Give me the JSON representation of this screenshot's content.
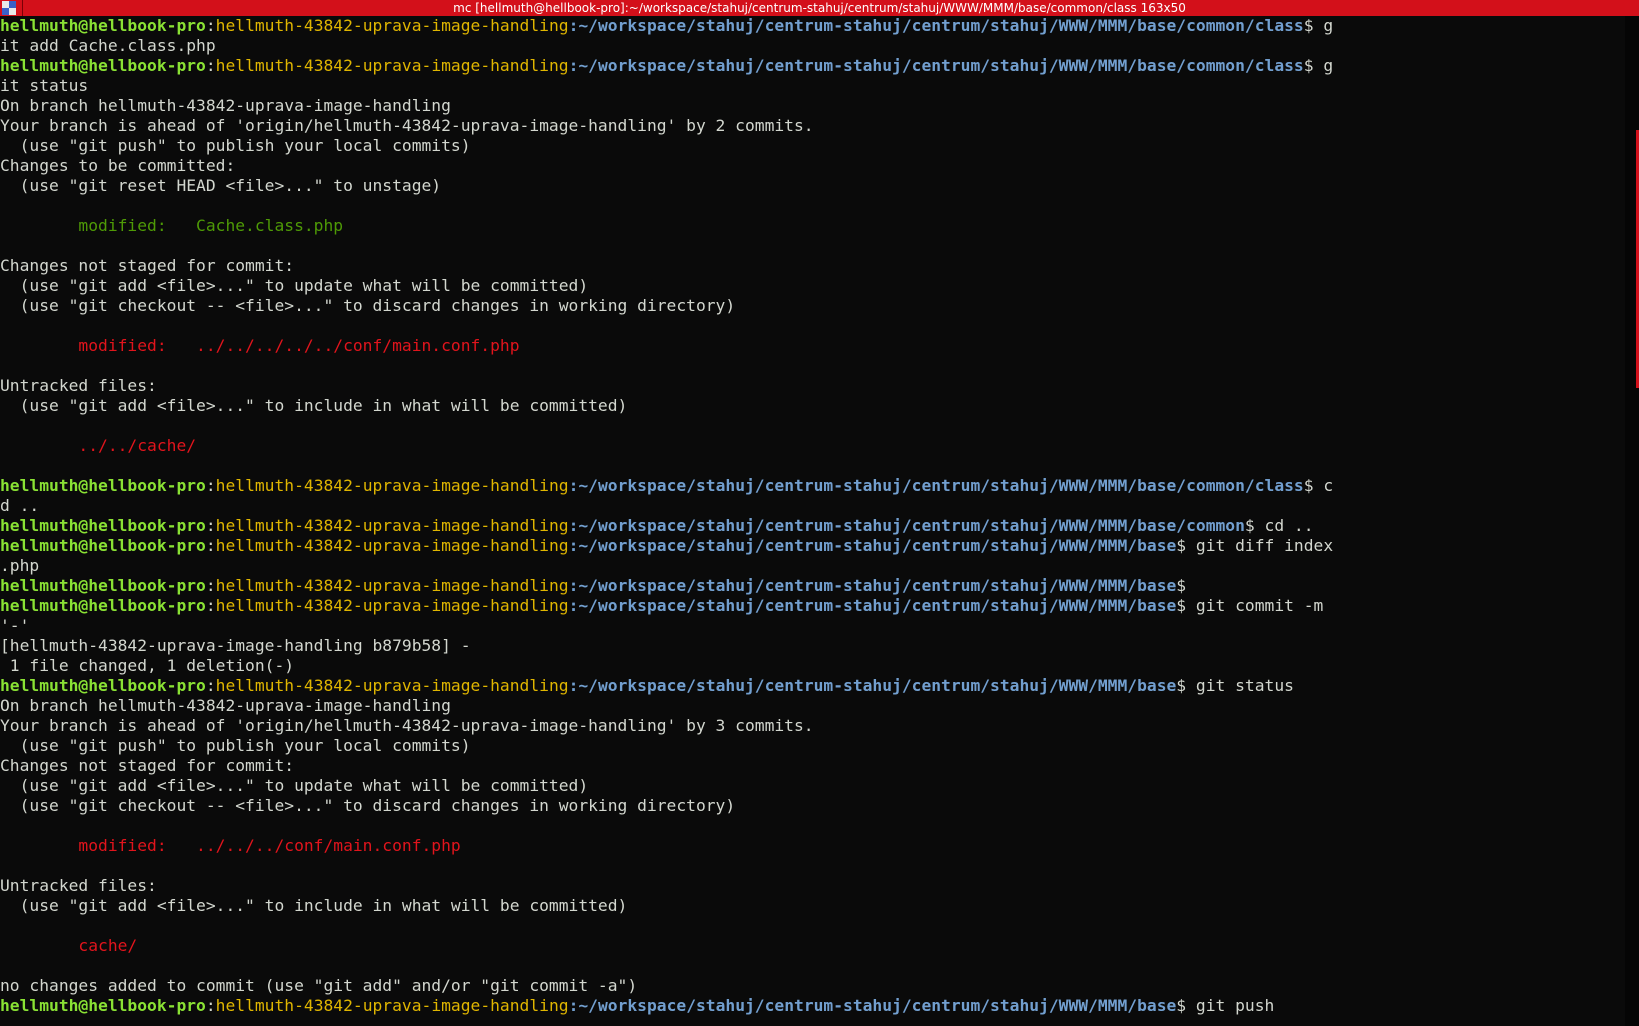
{
  "window": {
    "title": "mc [hellmuth@hellbook-pro]:~/workspace/stahuj/centrum-stahuj/centrum/stahuj/WWW/MMM/base/common/class 163x50"
  },
  "colors": {
    "title_bar": "#d3101a",
    "user_host": "#8ae234",
    "branch": "#e0b600",
    "path": "#729fcf",
    "text": "#d3d7cf",
    "staged": "#4e9a06",
    "unstaged": "#e1141c"
  },
  "terminal": {
    "lines": [
      [
        {
          "t": "hellmuth@hellbook-pro",
          "c": "user"
        },
        {
          "t": ":",
          "c": "plain"
        },
        {
          "t": "hellmuth-43842-uprava-image-handling",
          "c": "branch"
        },
        {
          "t": ":~/workspace/stahuj/centrum-stahuj/centrum/stahuj/WWW/MMM/base/common/class",
          "c": "path"
        },
        {
          "t": "$ g",
          "c": "plain"
        }
      ],
      [
        {
          "t": "it add Cache.class.php",
          "c": "plain"
        }
      ],
      [
        {
          "t": "hellmuth@hellbook-pro",
          "c": "user"
        },
        {
          "t": ":",
          "c": "plain"
        },
        {
          "t": "hellmuth-43842-uprava-image-handling",
          "c": "branch"
        },
        {
          "t": ":~/workspace/stahuj/centrum-stahuj/centrum/stahuj/WWW/MMM/base/common/class",
          "c": "path"
        },
        {
          "t": "$ g",
          "c": "plain"
        }
      ],
      [
        {
          "t": "it status",
          "c": "plain"
        }
      ],
      [
        {
          "t": "On branch hellmuth-43842-uprava-image-handling",
          "c": "plain"
        }
      ],
      [
        {
          "t": "Your branch is ahead of 'origin/hellmuth-43842-uprava-image-handling' by 2 commits.",
          "c": "plain"
        }
      ],
      [
        {
          "t": "  (use \"git push\" to publish your local commits)",
          "c": "plain"
        }
      ],
      [
        {
          "t": "Changes to be committed:",
          "c": "plain"
        }
      ],
      [
        {
          "t": "  (use \"git reset HEAD <file>...\" to unstage)",
          "c": "plain"
        }
      ],
      [
        {
          "t": "",
          "c": "plain"
        }
      ],
      [
        {
          "t": "        modified:   Cache.class.php",
          "c": "green"
        }
      ],
      [
        {
          "t": "",
          "c": "plain"
        }
      ],
      [
        {
          "t": "Changes not staged for commit:",
          "c": "plain"
        }
      ],
      [
        {
          "t": "  (use \"git add <file>...\" to update what will be committed)",
          "c": "plain"
        }
      ],
      [
        {
          "t": "  (use \"git checkout -- <file>...\" to discard changes in working directory)",
          "c": "plain"
        }
      ],
      [
        {
          "t": "",
          "c": "plain"
        }
      ],
      [
        {
          "t": "        modified:   ../../../../../conf/main.conf.php",
          "c": "red"
        }
      ],
      [
        {
          "t": "",
          "c": "plain"
        }
      ],
      [
        {
          "t": "Untracked files:",
          "c": "plain"
        }
      ],
      [
        {
          "t": "  (use \"git add <file>...\" to include in what will be committed)",
          "c": "plain"
        }
      ],
      [
        {
          "t": "",
          "c": "plain"
        }
      ],
      [
        {
          "t": "        ../../cache/",
          "c": "red"
        }
      ],
      [
        {
          "t": "",
          "c": "plain"
        }
      ],
      [
        {
          "t": "hellmuth@hellbook-pro",
          "c": "user"
        },
        {
          "t": ":",
          "c": "plain"
        },
        {
          "t": "hellmuth-43842-uprava-image-handling",
          "c": "branch"
        },
        {
          "t": ":~/workspace/stahuj/centrum-stahuj/centrum/stahuj/WWW/MMM/base/common/class",
          "c": "path"
        },
        {
          "t": "$ c",
          "c": "plain"
        }
      ],
      [
        {
          "t": "d ..",
          "c": "plain"
        }
      ],
      [
        {
          "t": "hellmuth@hellbook-pro",
          "c": "user"
        },
        {
          "t": ":",
          "c": "plain"
        },
        {
          "t": "hellmuth-43842-uprava-image-handling",
          "c": "branch"
        },
        {
          "t": ":~/workspace/stahuj/centrum-stahuj/centrum/stahuj/WWW/MMM/base/common",
          "c": "path"
        },
        {
          "t": "$ cd ..",
          "c": "plain"
        }
      ],
      [
        {
          "t": "hellmuth@hellbook-pro",
          "c": "user"
        },
        {
          "t": ":",
          "c": "plain"
        },
        {
          "t": "hellmuth-43842-uprava-image-handling",
          "c": "branch"
        },
        {
          "t": ":~/workspace/stahuj/centrum-stahuj/centrum/stahuj/WWW/MMM/base",
          "c": "path"
        },
        {
          "t": "$ git diff index",
          "c": "plain"
        }
      ],
      [
        {
          "t": ".php",
          "c": "plain"
        }
      ],
      [
        {
          "t": "hellmuth@hellbook-pro",
          "c": "user"
        },
        {
          "t": ":",
          "c": "plain"
        },
        {
          "t": "hellmuth-43842-uprava-image-handling",
          "c": "branch"
        },
        {
          "t": ":~/workspace/stahuj/centrum-stahuj/centrum/stahuj/WWW/MMM/base",
          "c": "path"
        },
        {
          "t": "$",
          "c": "plain"
        }
      ],
      [
        {
          "t": "hellmuth@hellbook-pro",
          "c": "user"
        },
        {
          "t": ":",
          "c": "plain"
        },
        {
          "t": "hellmuth-43842-uprava-image-handling",
          "c": "branch"
        },
        {
          "t": ":~/workspace/stahuj/centrum-stahuj/centrum/stahuj/WWW/MMM/base",
          "c": "path"
        },
        {
          "t": "$ git commit -m",
          "c": "plain"
        }
      ],
      [
        {
          "t": "'-'",
          "c": "plain"
        }
      ],
      [
        {
          "t": "[hellmuth-43842-uprava-image-handling b879b58] -",
          "c": "plain"
        }
      ],
      [
        {
          "t": " 1 file changed, 1 deletion(-)",
          "c": "plain"
        }
      ],
      [
        {
          "t": "hellmuth@hellbook-pro",
          "c": "user"
        },
        {
          "t": ":",
          "c": "plain"
        },
        {
          "t": "hellmuth-43842-uprava-image-handling",
          "c": "branch"
        },
        {
          "t": ":~/workspace/stahuj/centrum-stahuj/centrum/stahuj/WWW/MMM/base",
          "c": "path"
        },
        {
          "t": "$ git status",
          "c": "plain"
        }
      ],
      [
        {
          "t": "On branch hellmuth-43842-uprava-image-handling",
          "c": "plain"
        }
      ],
      [
        {
          "t": "Your branch is ahead of 'origin/hellmuth-43842-uprava-image-handling' by 3 commits.",
          "c": "plain"
        }
      ],
      [
        {
          "t": "  (use \"git push\" to publish your local commits)",
          "c": "plain"
        }
      ],
      [
        {
          "t": "Changes not staged for commit:",
          "c": "plain"
        }
      ],
      [
        {
          "t": "  (use \"git add <file>...\" to update what will be committed)",
          "c": "plain"
        }
      ],
      [
        {
          "t": "  (use \"git checkout -- <file>...\" to discard changes in working directory)",
          "c": "plain"
        }
      ],
      [
        {
          "t": "",
          "c": "plain"
        }
      ],
      [
        {
          "t": "        modified:   ../../../conf/main.conf.php",
          "c": "red"
        }
      ],
      [
        {
          "t": "",
          "c": "plain"
        }
      ],
      [
        {
          "t": "Untracked files:",
          "c": "plain"
        }
      ],
      [
        {
          "t": "  (use \"git add <file>...\" to include in what will be committed)",
          "c": "plain"
        }
      ],
      [
        {
          "t": "",
          "c": "plain"
        }
      ],
      [
        {
          "t": "        cache/",
          "c": "red"
        }
      ],
      [
        {
          "t": "",
          "c": "plain"
        }
      ],
      [
        {
          "t": "no changes added to commit (use \"git add\" and/or \"git commit -a\")",
          "c": "plain"
        }
      ],
      [
        {
          "t": "hellmuth@hellbook-pro",
          "c": "user"
        },
        {
          "t": ":",
          "c": "plain"
        },
        {
          "t": "hellmuth-43842-uprava-image-handling",
          "c": "branch"
        },
        {
          "t": ":~/workspace/stahuj/centrum-stahuj/centrum/stahuj/WWW/MMM/base",
          "c": "path"
        },
        {
          "t": "$ git push",
          "c": "plain"
        }
      ]
    ]
  }
}
